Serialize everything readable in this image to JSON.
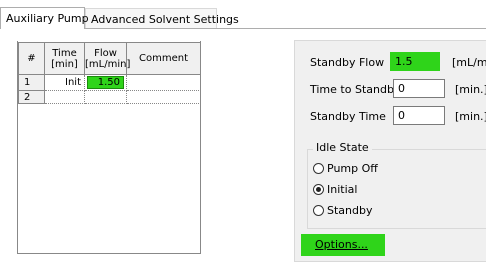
{
  "tabs": [
    {
      "label": "Auxiliary Pump",
      "active": true
    },
    {
      "label": "Advanced Solvent Settings",
      "active": false
    }
  ],
  "grid": {
    "headers": [
      "#",
      "Time\n[min]",
      "Flow\n[mL/min]",
      "Comment"
    ],
    "rows": [
      {
        "num": "1",
        "time": "Init",
        "flow": "1.50",
        "comment": ""
      },
      {
        "num": "2",
        "time": "",
        "flow": "",
        "comment": ""
      }
    ]
  },
  "standby": {
    "flow_label": "Standby Flow",
    "flow_value": "1.5",
    "flow_unit": "[mL/min]",
    "time_to_label": "Time to Standby",
    "time_to_value": "0",
    "time_to_unit": "[min.]",
    "time_label": "Standby Time",
    "time_value": "0",
    "time_unit": "[min.]"
  },
  "idle_state": {
    "title": "Idle State",
    "options": [
      {
        "label": "Pump Off",
        "selected": false
      },
      {
        "label": "Initial",
        "selected": true
      },
      {
        "label": "Standby",
        "selected": false
      }
    ]
  },
  "options_button": {
    "label": "Options..."
  },
  "colors": {
    "highlight": "#2fd41a"
  }
}
